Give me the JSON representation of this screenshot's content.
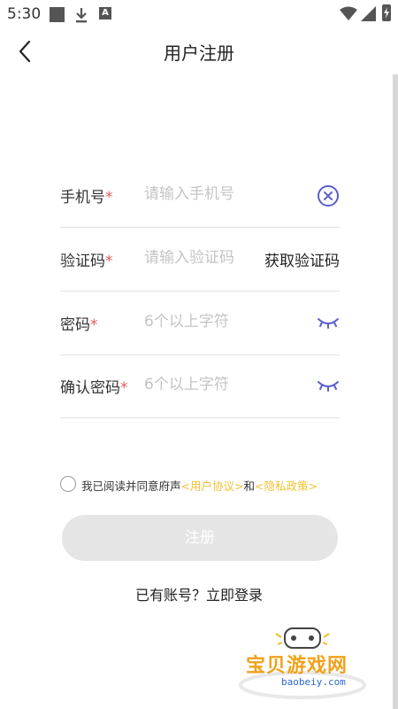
{
  "status_bar": {
    "time": "5:30",
    "icons": [
      "square-notification-icon",
      "download-icon",
      "a-icon",
      "wifi-icon",
      "signal-icon",
      "battery-charging-icon"
    ]
  },
  "header": {
    "title": "用户注册",
    "back_icon": "chevron-left-icon"
  },
  "form": {
    "phone": {
      "label": "手机号",
      "required_mark": "*",
      "placeholder": "请输入手机号",
      "value": "",
      "action_icon": "clear-circle-x-icon"
    },
    "code": {
      "label": "验证码",
      "required_mark": "*",
      "placeholder": "请输入验证码",
      "value": "",
      "action_label": "获取验证码"
    },
    "password": {
      "label": "密码",
      "required_mark": "*",
      "placeholder": "6个以上字符",
      "value": "",
      "action_icon": "eye-closed-icon"
    },
    "confirm": {
      "label": "确认密码",
      "required_mark": "*",
      "placeholder": "6个以上字符",
      "value": "",
      "action_icon": "eye-closed-icon"
    }
  },
  "agreement": {
    "checked": false,
    "prefix": "我已阅读并同意府声",
    "user_agreement": "<用户协议>",
    "and": "和",
    "privacy_policy": "<隐私政策>"
  },
  "register_button": {
    "label": "注册"
  },
  "login_link": {
    "label": "已有账号？立即登录"
  },
  "watermark": {
    "brand": "宝贝游戏网",
    "url": "baobeiy.com"
  },
  "colors": {
    "accent_icon": "#5a5fc9",
    "required": "#e25b5b",
    "link": "#f2c233",
    "button_disabled": "#e5e5e5"
  }
}
